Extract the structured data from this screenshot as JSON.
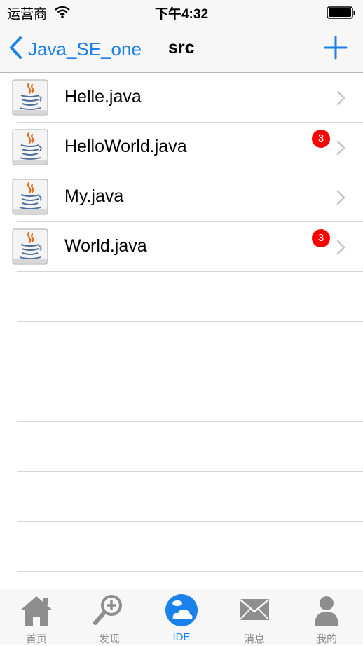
{
  "status_bar": {
    "carrier": "运营商",
    "time": "下午4:32"
  },
  "nav": {
    "back_label": "Java_SE_one",
    "title": "src",
    "add_icon": "plus-icon",
    "tint": "#1a82ea"
  },
  "files": [
    {
      "name": "Helle.java",
      "badge": ""
    },
    {
      "name": "HelloWorld.java",
      "badge": "3"
    },
    {
      "name": "My.java",
      "badge": ""
    },
    {
      "name": "World.java",
      "badge": "3"
    }
  ],
  "tabs": [
    {
      "label": "首页",
      "icon": "home-icon"
    },
    {
      "label": "发现",
      "icon": "magnifier-plus-icon"
    },
    {
      "label": "IDE",
      "icon": "cloud-globe-icon",
      "active": true
    },
    {
      "label": "消息",
      "icon": "envelope-icon"
    },
    {
      "label": "我的",
      "icon": "person-icon"
    }
  ],
  "colors": {
    "accent": "#1a82ea",
    "badge": "#ff0000",
    "tab_inactive": "#8e8e8e"
  }
}
